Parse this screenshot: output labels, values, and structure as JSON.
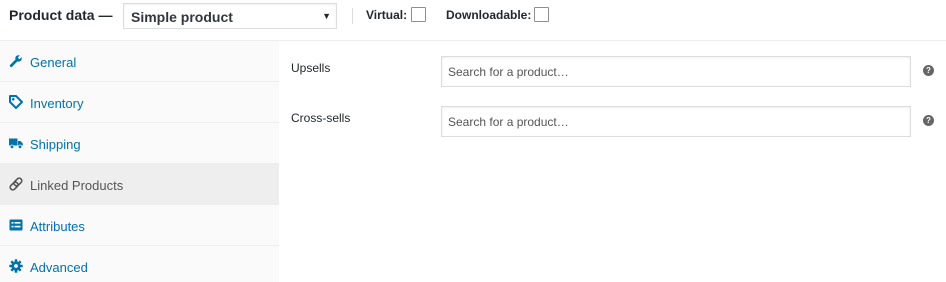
{
  "header": {
    "title": "Product data —",
    "product_type": "Simple product",
    "virtual_label": "Virtual:",
    "downloadable_label": "Downloadable:"
  },
  "tabs": [
    {
      "label": "General",
      "icon": "wrench-icon",
      "active": false
    },
    {
      "label": "Inventory",
      "icon": "tag-icon",
      "active": false
    },
    {
      "label": "Shipping",
      "icon": "truck-icon",
      "active": false
    },
    {
      "label": "Linked Products",
      "icon": "link-icon",
      "active": true
    },
    {
      "label": "Attributes",
      "icon": "list-icon",
      "active": false
    },
    {
      "label": "Advanced",
      "icon": "gear-icon",
      "active": false
    }
  ],
  "fields": {
    "upsells": {
      "label": "Upsells",
      "placeholder": "Search for a product…"
    },
    "cross_sells": {
      "label": "Cross-sells",
      "placeholder": "Search for a product…"
    },
    "help_glyph": "?"
  },
  "colors": {
    "link": "#0073aa",
    "active_tab_bg": "#eeeeee",
    "sidebar_bg": "#fafafa"
  }
}
